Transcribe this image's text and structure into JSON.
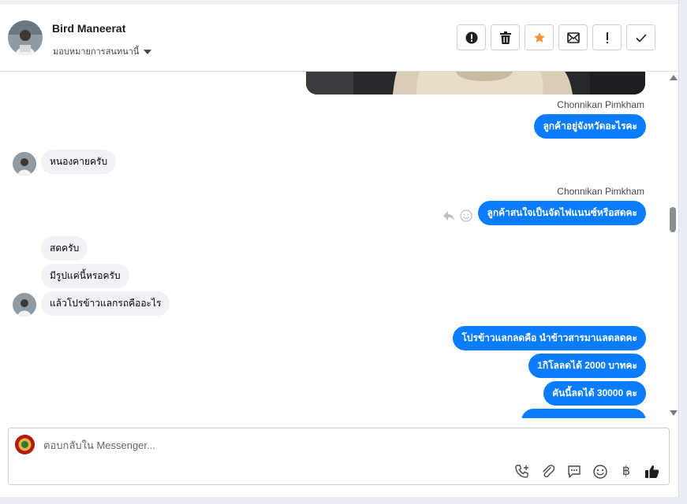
{
  "header": {
    "name": "Bird Maneerat",
    "assign_label": "มอบหมายการสนทนานี้",
    "actions": [
      "alert-icon",
      "trash-icon",
      "star-icon",
      "mark-unread-icon",
      "spam-icon",
      "check-icon"
    ],
    "star_color": "#f7923b"
  },
  "thread": {
    "messages": [
      {
        "from": "agent",
        "sender": "Chonnikan Pimkham",
        "text": "ลูกค้าอยู่จังหวัดอะไรคะ"
      },
      {
        "from": "customer",
        "text": "หนองคายครับ"
      },
      {
        "from": "agent",
        "sender": "Chonnikan Pimkham",
        "text": "ลูกค้าสนใจเป็นจัดไฟแนนซ์หรือสดคะ"
      },
      {
        "from": "customer",
        "text": "สดครับ"
      },
      {
        "from": "customer",
        "text": "มีรูปแค่นี้หรอครับ"
      },
      {
        "from": "customer",
        "text": "แล้วโปรข้าวแลกรถคืออะไร"
      },
      {
        "from": "agent",
        "text": "โปรข้าวแลกลดคือ นำข้าวสารมาแลดลดคะ"
      },
      {
        "from": "agent",
        "text": "1กิโลลดได้ 2000 บาทคะ"
      },
      {
        "from": "agent",
        "text": "คันนี้ลดได้ 30000 คะ"
      }
    ],
    "outgoing_color": "#0a7cff"
  },
  "composer": {
    "placeholder": "ตอบกลับใน Messenger...",
    "tools": [
      "add-call-icon",
      "attach-icon",
      "saved-reply-icon",
      "emoji-icon",
      "baht-icon",
      "like-icon"
    ],
    "baht_symbol": "฿"
  }
}
